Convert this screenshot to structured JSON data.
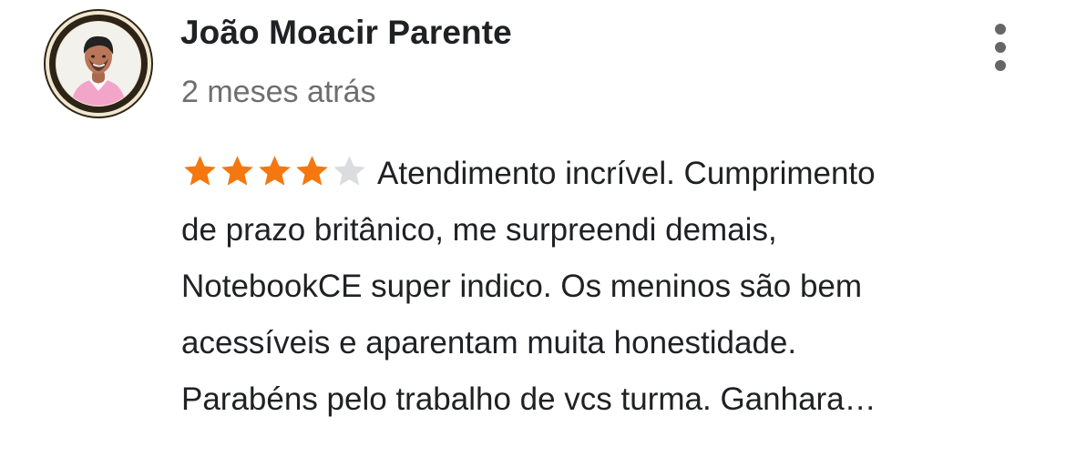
{
  "review": {
    "author_name": "João Moacir Parente",
    "timestamp": "2 meses atrás",
    "rating": {
      "value": 4,
      "max": 5,
      "filled_color": "#f4770f",
      "empty_color": "#dadce0"
    },
    "text_lines": [
      "Atendimento incrível. Cumprimento",
      "de prazo britânico, me surpreendi demais,",
      "NotebookCE super indico. Os meninos são bem",
      "acessíveis e aparentam muita honestidade.",
      "Parabéns pelo trabalho de vcs turma. Ganhara…"
    ],
    "menu_icon": "more-vertical-icon",
    "avatar_icon": "user-avatar"
  }
}
